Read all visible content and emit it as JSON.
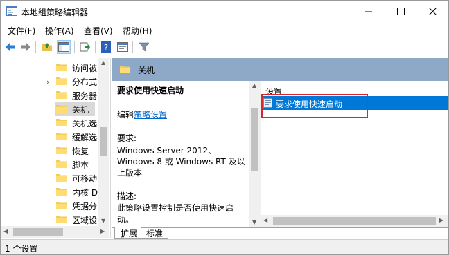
{
  "window": {
    "title": "本地组策略编辑器"
  },
  "menu": {
    "items": [
      "文件(F)",
      "操作(A)",
      "查看(V)",
      "帮助(H)"
    ]
  },
  "tree": {
    "items": [
      {
        "label": "访问被",
        "expandable": false,
        "selected": false
      },
      {
        "label": "分布式",
        "expandable": true,
        "selected": false
      },
      {
        "label": "服务器",
        "expandable": false,
        "selected": false
      },
      {
        "label": "关机",
        "expandable": false,
        "selected": true
      },
      {
        "label": "关机选",
        "expandable": false,
        "selected": false
      },
      {
        "label": "缓解选",
        "expandable": false,
        "selected": false
      },
      {
        "label": "恢复",
        "expandable": false,
        "selected": false
      },
      {
        "label": "脚本",
        "expandable": false,
        "selected": false
      },
      {
        "label": "可移动",
        "expandable": false,
        "selected": false
      },
      {
        "label": "内核 D",
        "expandable": false,
        "selected": false
      },
      {
        "label": "凭据分",
        "expandable": false,
        "selected": false
      },
      {
        "label": "区域设",
        "expandable": false,
        "selected": false
      }
    ]
  },
  "banner": {
    "title": "关机"
  },
  "description": {
    "heading": "要求使用快速启动",
    "edit_prefix": "编辑",
    "edit_link": "策略设置",
    "requirements_label": "要求:",
    "requirements_line1": "Windows Server 2012、",
    "requirements_line2": "Windows 8 或 Windows RT 及以",
    "requirements_line3": "上版本",
    "desc_label": "描述:",
    "desc_line1": "此策略设置控制是否使用快速启",
    "desc_line2": "动。"
  },
  "list": {
    "header": "设置",
    "items": [
      {
        "label": "要求使用快速启动",
        "selected": true
      }
    ]
  },
  "tabs": {
    "extended": "扩展",
    "standard": "标准"
  },
  "status": {
    "text": "1 个设置"
  },
  "colors": {
    "selection": "#0078d7",
    "banner": "#8ea8c8",
    "highlight_box": "#d9262a",
    "link": "#0066cc"
  }
}
